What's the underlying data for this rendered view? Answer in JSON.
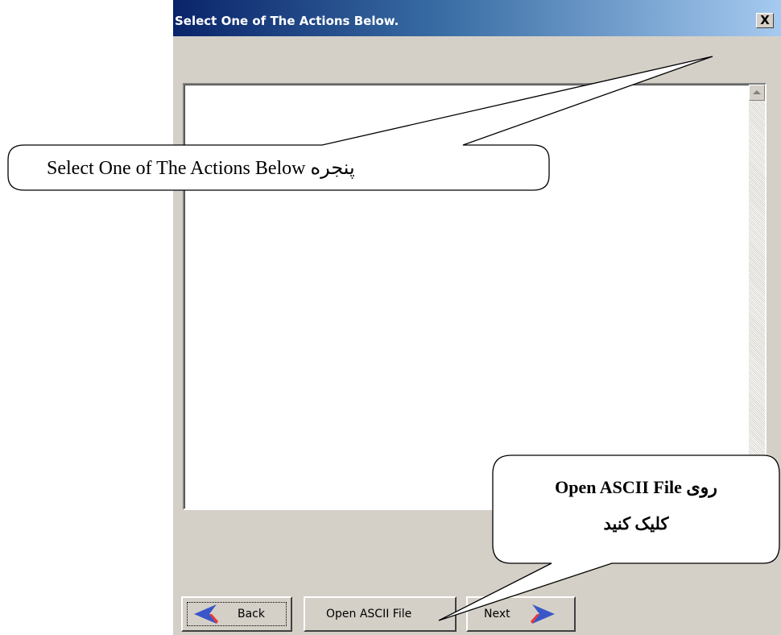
{
  "window": {
    "title": "Select One of The Actions Below.",
    "close_glyph": "X"
  },
  "buttons": {
    "back": "Back",
    "open_ascii": "Open ASCII File",
    "next": "Next"
  },
  "icons": {
    "back": "left-arrow-icon",
    "next": "right-arrow-icon",
    "close": "close-icon",
    "scroll_up": "scroll-up-arrow-icon"
  },
  "callouts": {
    "window_note": "Select One of The Actions Below پنجره",
    "click_note_line1": "روی Open ASCII File",
    "click_note_line2": "کلیک کنید"
  },
  "colors": {
    "title_gradient_start": "#0a246a",
    "title_gradient_end": "#a6caf0",
    "dialog_face": "#d4d0c8",
    "arrow_back": "#3a56c8",
    "arrow_next": "#3a56c8"
  }
}
